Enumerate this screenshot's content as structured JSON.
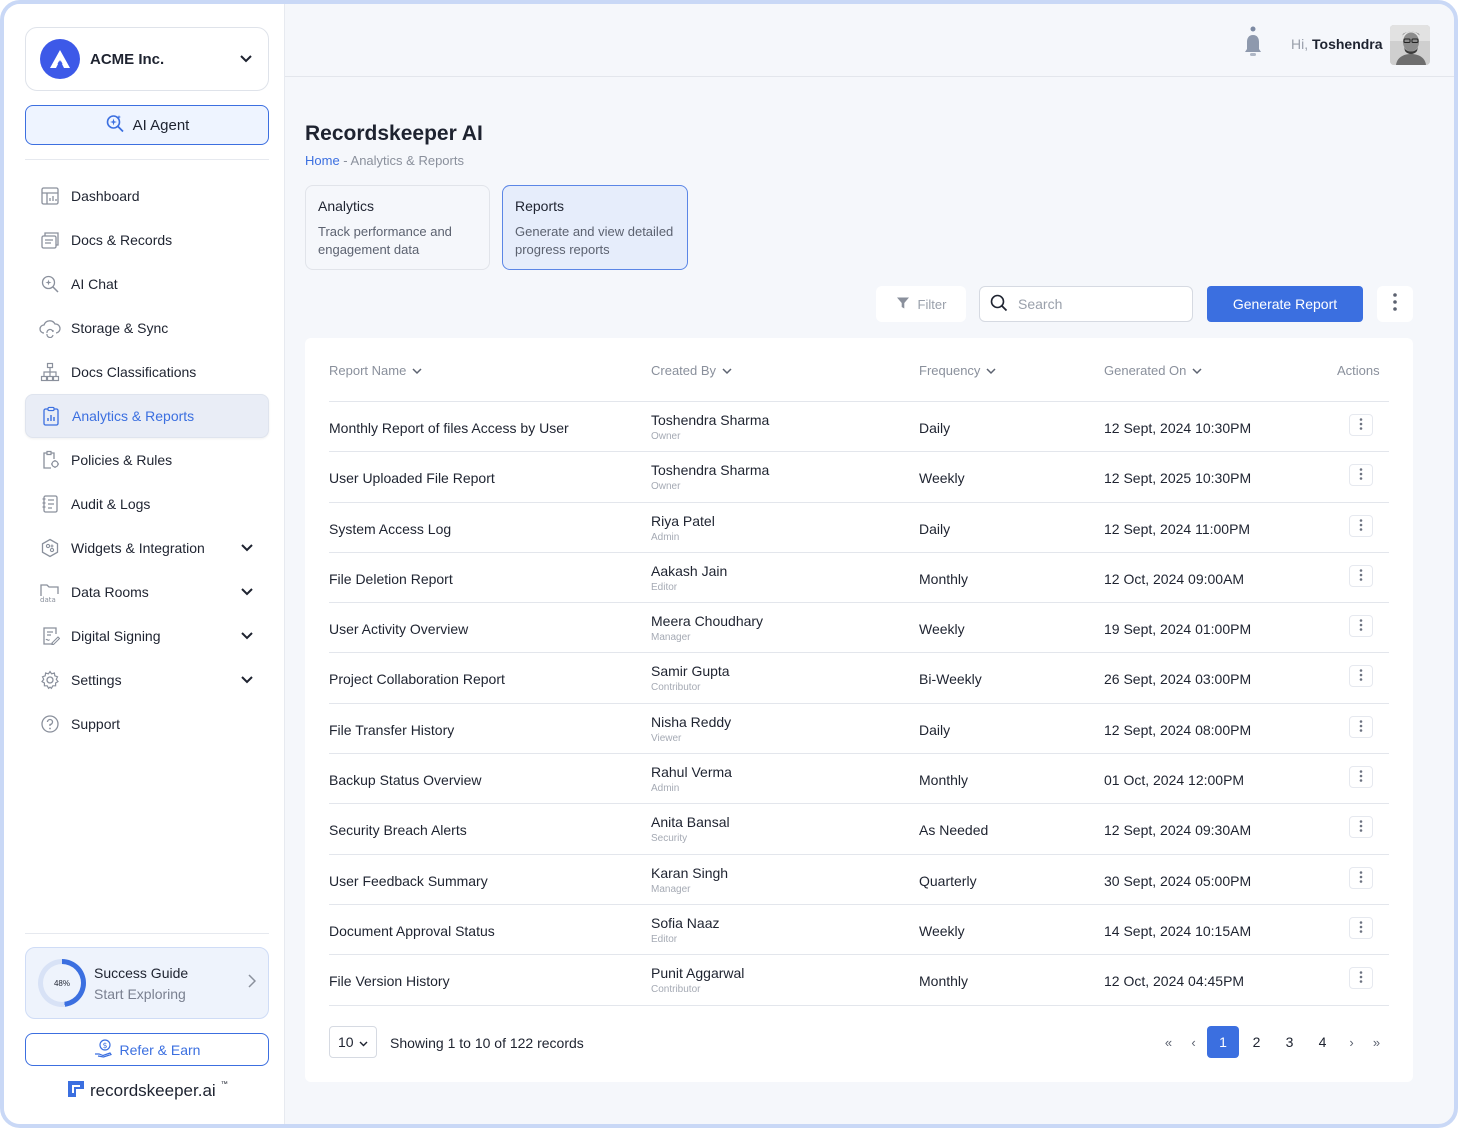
{
  "sidebar": {
    "org_name": "ACME Inc.",
    "ai_agent_label": "AI Agent",
    "nav": [
      {
        "label": "Dashboard",
        "icon": "dashboard-icon",
        "active": false,
        "expandable": false
      },
      {
        "label": "Docs & Records",
        "icon": "docs-records-icon",
        "active": false,
        "expandable": false
      },
      {
        "label": "AI Chat",
        "icon": "ai-chat-icon",
        "active": false,
        "expandable": false
      },
      {
        "label": "Storage & Sync",
        "icon": "cloud-sync-icon",
        "active": false,
        "expandable": false
      },
      {
        "label": "Docs Classifications",
        "icon": "hierarchy-icon",
        "active": false,
        "expandable": false
      },
      {
        "label": "Analytics & Reports",
        "icon": "clipboard-chart-icon",
        "active": true,
        "expandable": false
      },
      {
        "label": "Policies & Rules",
        "icon": "policy-icon",
        "active": false,
        "expandable": false
      },
      {
        "label": "Audit & Logs",
        "icon": "audit-log-icon",
        "active": false,
        "expandable": false
      },
      {
        "label": "Widgets & Integration",
        "icon": "widgets-icon",
        "active": false,
        "expandable": true
      },
      {
        "label": "Data Rooms",
        "icon": "data-folder-icon",
        "active": false,
        "expandable": true
      },
      {
        "label": "Digital Signing",
        "icon": "signing-icon",
        "active": false,
        "expandable": true
      },
      {
        "label": "Settings",
        "icon": "gear-icon",
        "active": false,
        "expandable": true
      },
      {
        "label": "Support",
        "icon": "help-circle-icon",
        "active": false,
        "expandable": false
      }
    ],
    "guide": {
      "progress_label": "48%",
      "progress": 0.48,
      "title": "Success Guide",
      "subtitle": "Start Exploring"
    },
    "refer_label": "Refer & Earn",
    "brand_name": "recordskeeper.ai",
    "brand_tm": "™"
  },
  "topbar": {
    "greeting_prefix": "Hi,",
    "user_name": "Toshendra"
  },
  "page": {
    "title": "Recordskeeper AI",
    "breadcrumb_home": "Home",
    "breadcrumb_sep": " - ",
    "breadcrumb_current": "Analytics & Reports"
  },
  "cards": {
    "analytics": {
      "title": "Analytics",
      "desc": "Track performance and engagement data"
    },
    "reports": {
      "title": "Reports",
      "desc": "Generate and view detailed progress reports"
    }
  },
  "toolbar": {
    "filter_label": "Filter",
    "search_placeholder": "Search",
    "generate_label": "Generate Report"
  },
  "table": {
    "headers": {
      "name": "Report Name",
      "created_by": "Created By",
      "frequency": "Frequency",
      "generated_on": "Generated On",
      "actions": "Actions"
    },
    "rows": [
      {
        "name": "Monthly Report of files Access by User",
        "by": "Toshendra Sharma",
        "role": "Owner",
        "freq": "Daily",
        "date": "12 Sept, 2024 10:30PM"
      },
      {
        "name": "User Uploaded File Report",
        "by": "Toshendra Sharma",
        "role": "Owner",
        "freq": "Weekly",
        "date": "12 Sept, 2025 10:30PM"
      },
      {
        "name": "System Access Log",
        "by": "Riya Patel",
        "role": "Admin",
        "freq": "Daily",
        "date": "12 Sept, 2024 11:00PM"
      },
      {
        "name": "File Deletion Report",
        "by": "Aakash Jain",
        "role": "Editor",
        "freq": "Monthly",
        "date": "12 Oct, 2024 09:00AM"
      },
      {
        "name": "User Activity Overview",
        "by": "Meera Choudhary",
        "role": "Manager",
        "freq": "Weekly",
        "date": "19 Sept, 2024 01:00PM"
      },
      {
        "name": "Project Collaboration Report",
        "by": "Samir Gupta",
        "role": "Contributor",
        "freq": "Bi-Weekly",
        "date": "26 Sept, 2024 03:00PM"
      },
      {
        "name": "File Transfer History",
        "by": "Nisha Reddy",
        "role": "Viewer",
        "freq": "Daily",
        "date": "12 Sept, 2024 08:00PM"
      },
      {
        "name": "Backup Status Overview",
        "by": "Rahul Verma",
        "role": "Admin",
        "freq": "Monthly",
        "date": "01 Oct, 2024 12:00PM"
      },
      {
        "name": "Security Breach Alerts",
        "by": "Anita Bansal",
        "role": "Security",
        "freq": "As Needed",
        "date": "12 Sept, 2024 09:30AM"
      },
      {
        "name": "User Feedback Summary",
        "by": "Karan Singh",
        "role": "Manager",
        "freq": "Quarterly",
        "date": "30 Sept, 2024 05:00PM"
      },
      {
        "name": "Document Approval Status",
        "by": "Sofia Naaz",
        "role": "Editor",
        "freq": "Weekly",
        "date": "14 Sept, 2024 10:15AM"
      },
      {
        "name": "File Version History",
        "by": "Punit Aggarwal",
        "role": "Contributor",
        "freq": "Monthly",
        "date": "12 Oct, 2024 04:45PM"
      }
    ]
  },
  "pagination": {
    "per_page": "10",
    "summary": "Showing 1 to 10 of 122 records",
    "first": "«",
    "prev": "‹",
    "pages": [
      "1",
      "2",
      "3",
      "4"
    ],
    "current": "1",
    "next": "›",
    "last": "»"
  },
  "colors": {
    "accent": "#3b6fe0",
    "org_logo": "#3d59e8",
    "frame_border": "#c9d8f6"
  }
}
